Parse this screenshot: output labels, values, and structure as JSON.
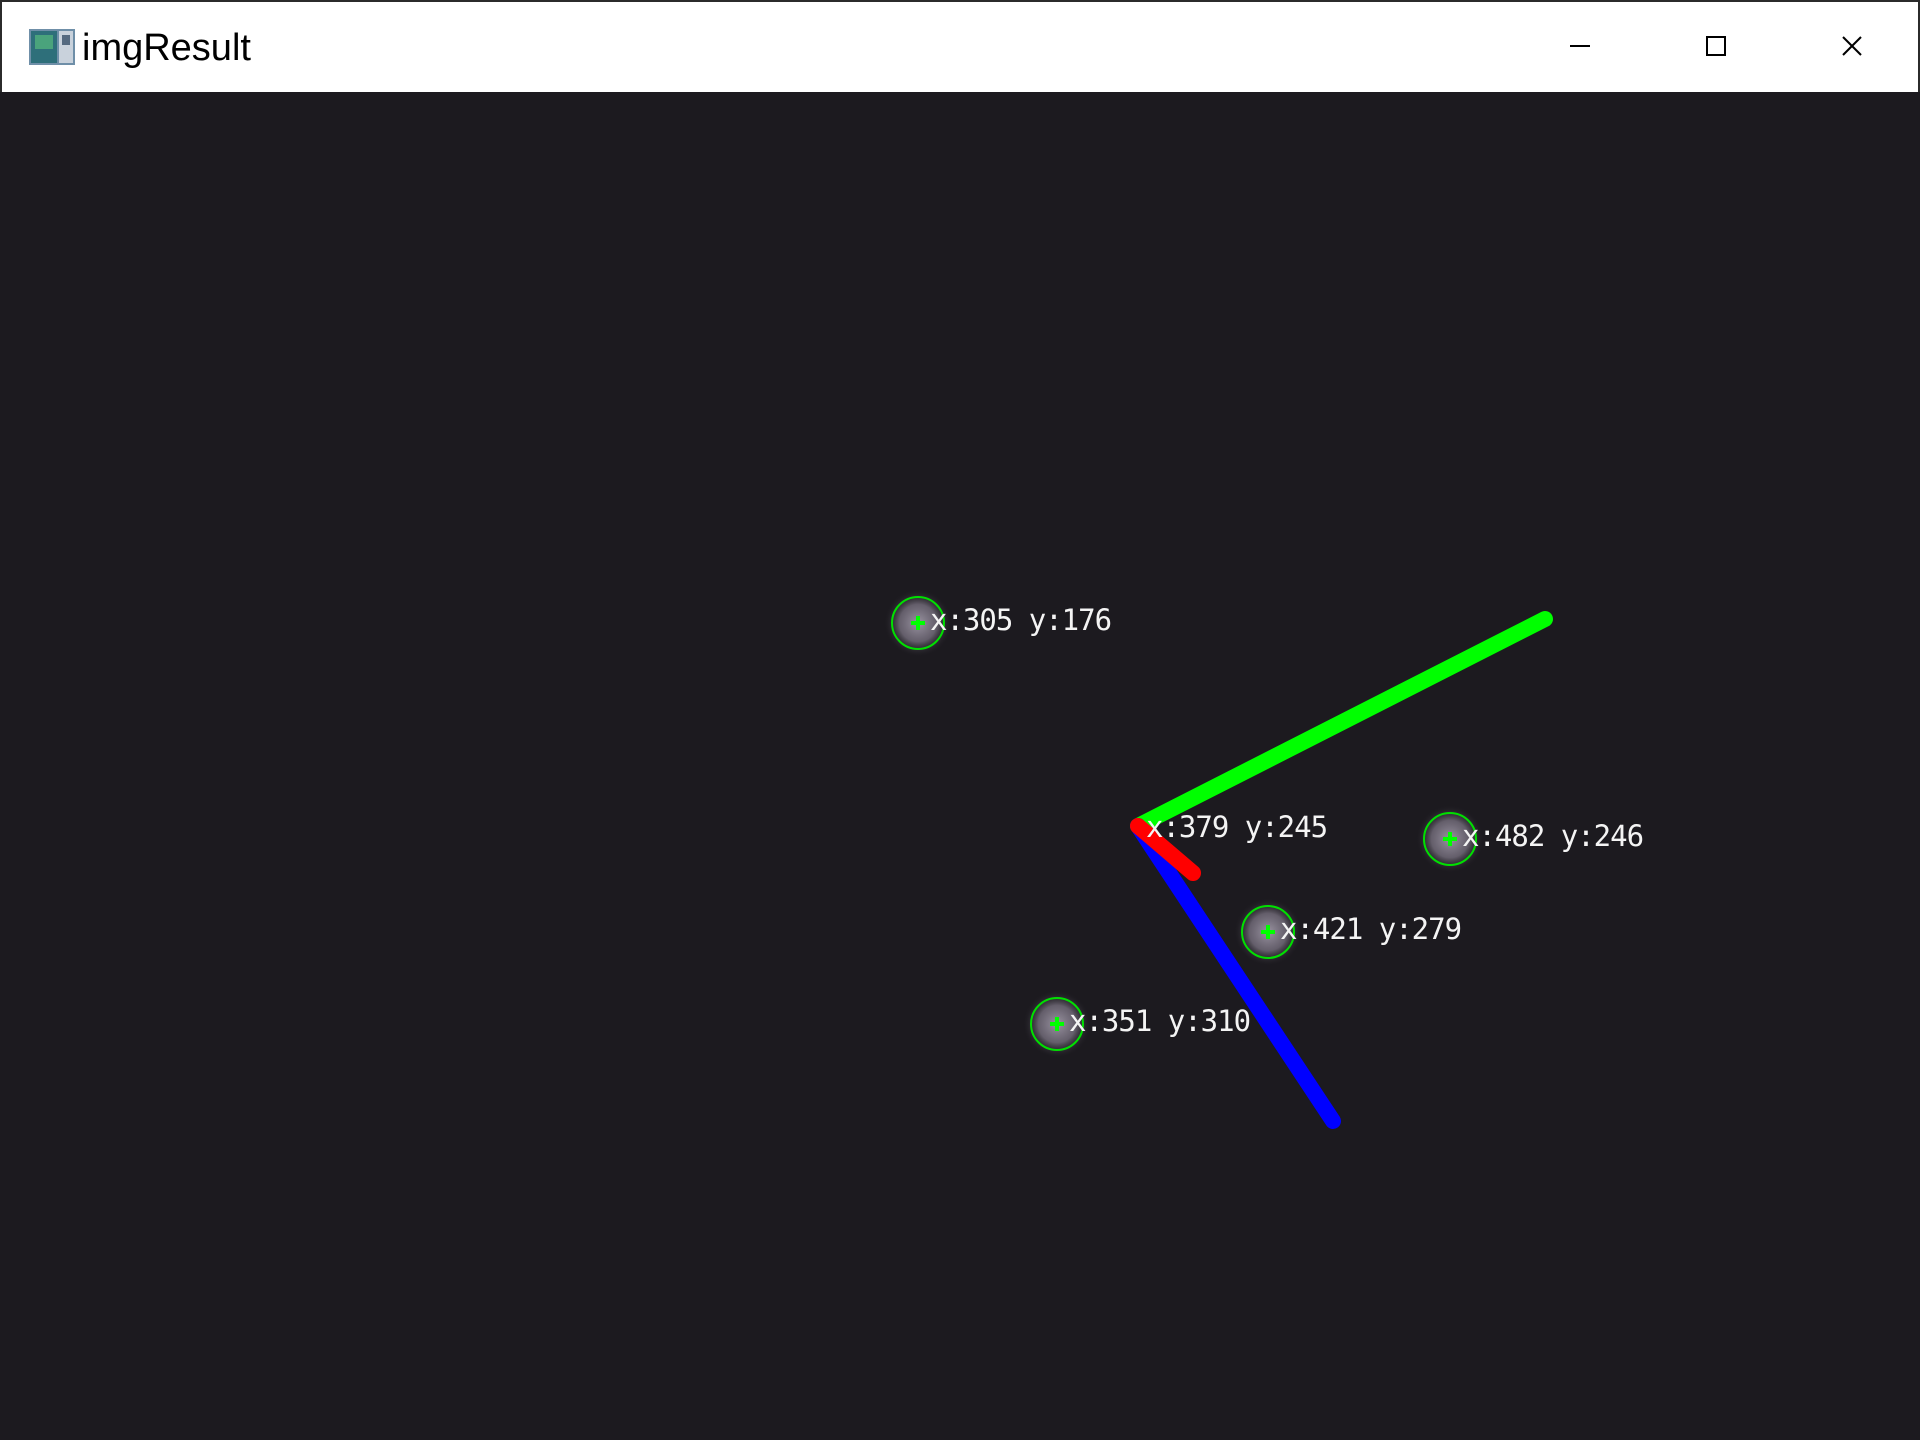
{
  "window": {
    "title": "imgResult",
    "controls": {
      "minimize": "minimize-icon",
      "maximize": "maximize-icon",
      "close": "close-icon"
    }
  },
  "canvas": {
    "background": "#1c1a1f",
    "axes": {
      "x_axis_color": "#ff0000",
      "y_axis_color": "#00ff00",
      "z_axis_color": "#0000ff"
    },
    "points": [
      {
        "label": "x:305 y:176"
      },
      {
        "label": "x:379 y:245"
      },
      {
        "label": "x:482 y:246"
      },
      {
        "label": "x:421 y:279"
      },
      {
        "label": "x:351 y:310"
      }
    ]
  }
}
